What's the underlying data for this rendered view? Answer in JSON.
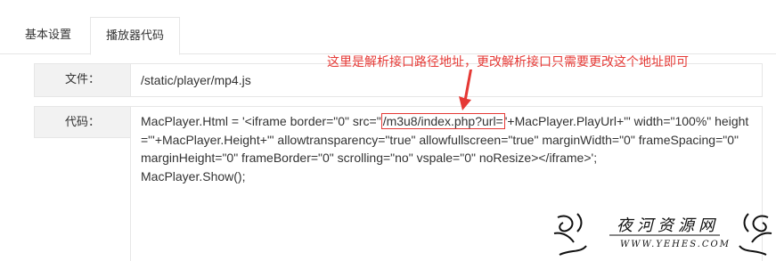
{
  "tabs": [
    {
      "label": "基本设置"
    },
    {
      "label": "播放器代码"
    }
  ],
  "file_row": {
    "label": "文件：",
    "value": "/static/player/mp4.js"
  },
  "code_row": {
    "label": "代码：",
    "code_before": "MacPlayer.Html = '<iframe border=\"0\" src=\"",
    "code_highlight": "/m3u8/index.php?url=",
    "code_after": "'+MacPlayer.PlayUrl+'\" width=\"100%\" height=\"'+MacPlayer.Height+'\" allowtransparency=\"true\" allowfullscreen=\"true\" marginWidth=\"0\" frameSpacing=\"0\" marginHeight=\"0\" frameBorder=\"0\" scrolling=\"no\" vspale=\"0\" noResize></iframe>';\nMacPlayer.Show();"
  },
  "annotation": {
    "text": "这里是解析接口路径地址，更改解析接口只需要更改这个地址即可",
    "color": "#e53935"
  },
  "watermark": {
    "title": "夜河资源网",
    "url": "WWW.YEHES.COM"
  }
}
